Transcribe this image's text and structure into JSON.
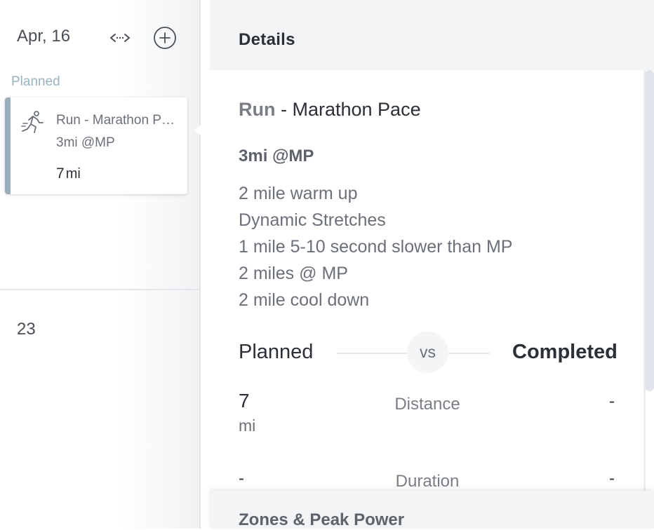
{
  "calendar": {
    "day_date": "Apr, 16",
    "planned_label": "Planned",
    "next_week_day": "23",
    "card": {
      "title": "Run - Marathon Pace",
      "subtitle": "3mi @MP",
      "distance_value": "7",
      "distance_unit": "mi",
      "accent_color": "#9aadbb"
    },
    "icons": [
      "expand-icon",
      "add-circle-icon",
      "runner-icon"
    ]
  },
  "details": {
    "header_title": "Details",
    "sport": "Run",
    "separator": " - ",
    "workout_name": "Marathon Pace",
    "subtitle": "3mi @MP",
    "description_lines": [
      "2 mile warm up",
      "Dynamic Stretches",
      "1 mile 5-10 second slower than MP",
      "2 miles @ MP",
      "2 mile cool down"
    ],
    "comparison": {
      "planned_label": "Planned",
      "vs_label": "vs",
      "completed_label": "Completed"
    },
    "metrics": [
      {
        "label": "Distance",
        "planned_value": "7",
        "planned_unit": "mi",
        "completed_value": "-"
      },
      {
        "label": "Duration",
        "planned_value": "-",
        "planned_unit": "",
        "completed_value": "-"
      }
    ],
    "zones_title": "Zones & Peak Power"
  }
}
